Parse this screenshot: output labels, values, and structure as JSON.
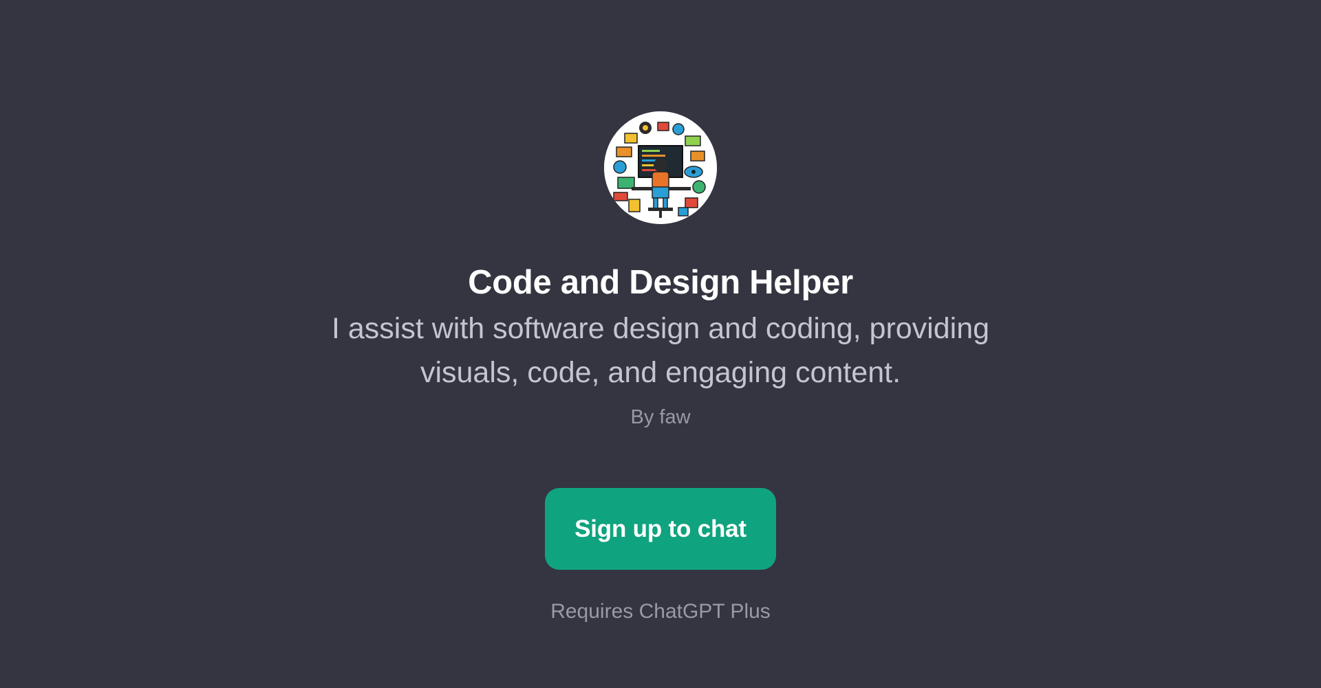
{
  "gpt": {
    "name": "Code and Design Helper",
    "description": "I assist with software design and coding, providing visuals, code, and engaging content.",
    "author": "By faw",
    "avatar_icon": "developer-workspace-illustration"
  },
  "actions": {
    "signup_label": "Sign up to chat",
    "requirement": "Requires ChatGPT Plus"
  },
  "colors": {
    "background": "#343541",
    "accent": "#10a37f",
    "title": "#ffffff",
    "description": "#c5c5d2",
    "muted": "#9a9aa6"
  }
}
